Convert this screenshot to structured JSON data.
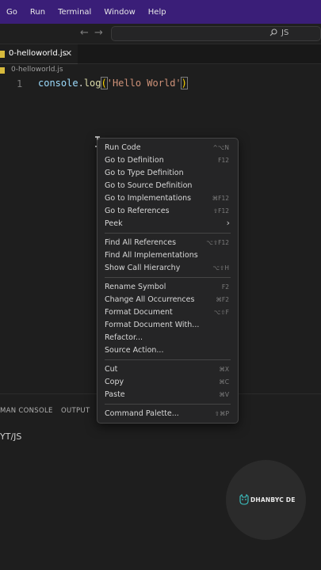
{
  "menubar": {
    "items": [
      "Go",
      "Run",
      "Terminal",
      "Window",
      "Help"
    ]
  },
  "titlebar": {
    "search_label": "JS"
  },
  "tab": {
    "label": "0-helloworld.js",
    "close": "✕"
  },
  "breadcrumb": {
    "label": "0-helloworld.js"
  },
  "editor": {
    "line_number": "1",
    "code": {
      "obj": "console",
      "dot": ".",
      "fn": "log",
      "open": "(",
      "str": "'Hello World'",
      "close": ")"
    }
  },
  "context_menu": {
    "items": [
      {
        "label": "Run Code",
        "shortcut": "^⌥N"
      },
      {
        "label": "Go to Definition",
        "shortcut": "F12"
      },
      {
        "label": "Go to Type Definition",
        "shortcut": ""
      },
      {
        "label": "Go to Source Definition",
        "shortcut": ""
      },
      {
        "label": "Go to Implementations",
        "shortcut": "⌘F12"
      },
      {
        "label": "Go to References",
        "shortcut": "⇧F12"
      },
      {
        "label": "Peek",
        "shortcut": ""
      },
      {
        "label": "Find All References",
        "shortcut": "⌥⇧F12"
      },
      {
        "label": "Find All Implementations",
        "shortcut": ""
      },
      {
        "label": "Show Call Hierarchy",
        "shortcut": "⌥⇧H"
      },
      {
        "label": "Rename Symbol",
        "shortcut": "F2"
      },
      {
        "label": "Change All Occurrences",
        "shortcut": "⌘F2"
      },
      {
        "label": "Format Document",
        "shortcut": "⌥⇧F"
      },
      {
        "label": "Format Document With...",
        "shortcut": ""
      },
      {
        "label": "Refactor...",
        "shortcut": ""
      },
      {
        "label": "Source Action...",
        "shortcut": ""
      },
      {
        "label": "Cut",
        "shortcut": "⌘X"
      },
      {
        "label": "Copy",
        "shortcut": "⌘C"
      },
      {
        "label": "Paste",
        "shortcut": "⌘V"
      },
      {
        "label": "Command Palette...",
        "shortcut": "⇧⌘P"
      }
    ],
    "peek_arrow": "›"
  },
  "panel": {
    "tabs": [
      "MAN CONSOLE",
      "OUTPUT"
    ],
    "text": "YT/JS"
  },
  "watermark": {
    "text": "DHANBYC DE"
  },
  "colors": {
    "menubar": "#3a1e78",
    "js_badge": "#d7ba3c",
    "string": "#ce9178",
    "function": "#dcdcaa"
  }
}
